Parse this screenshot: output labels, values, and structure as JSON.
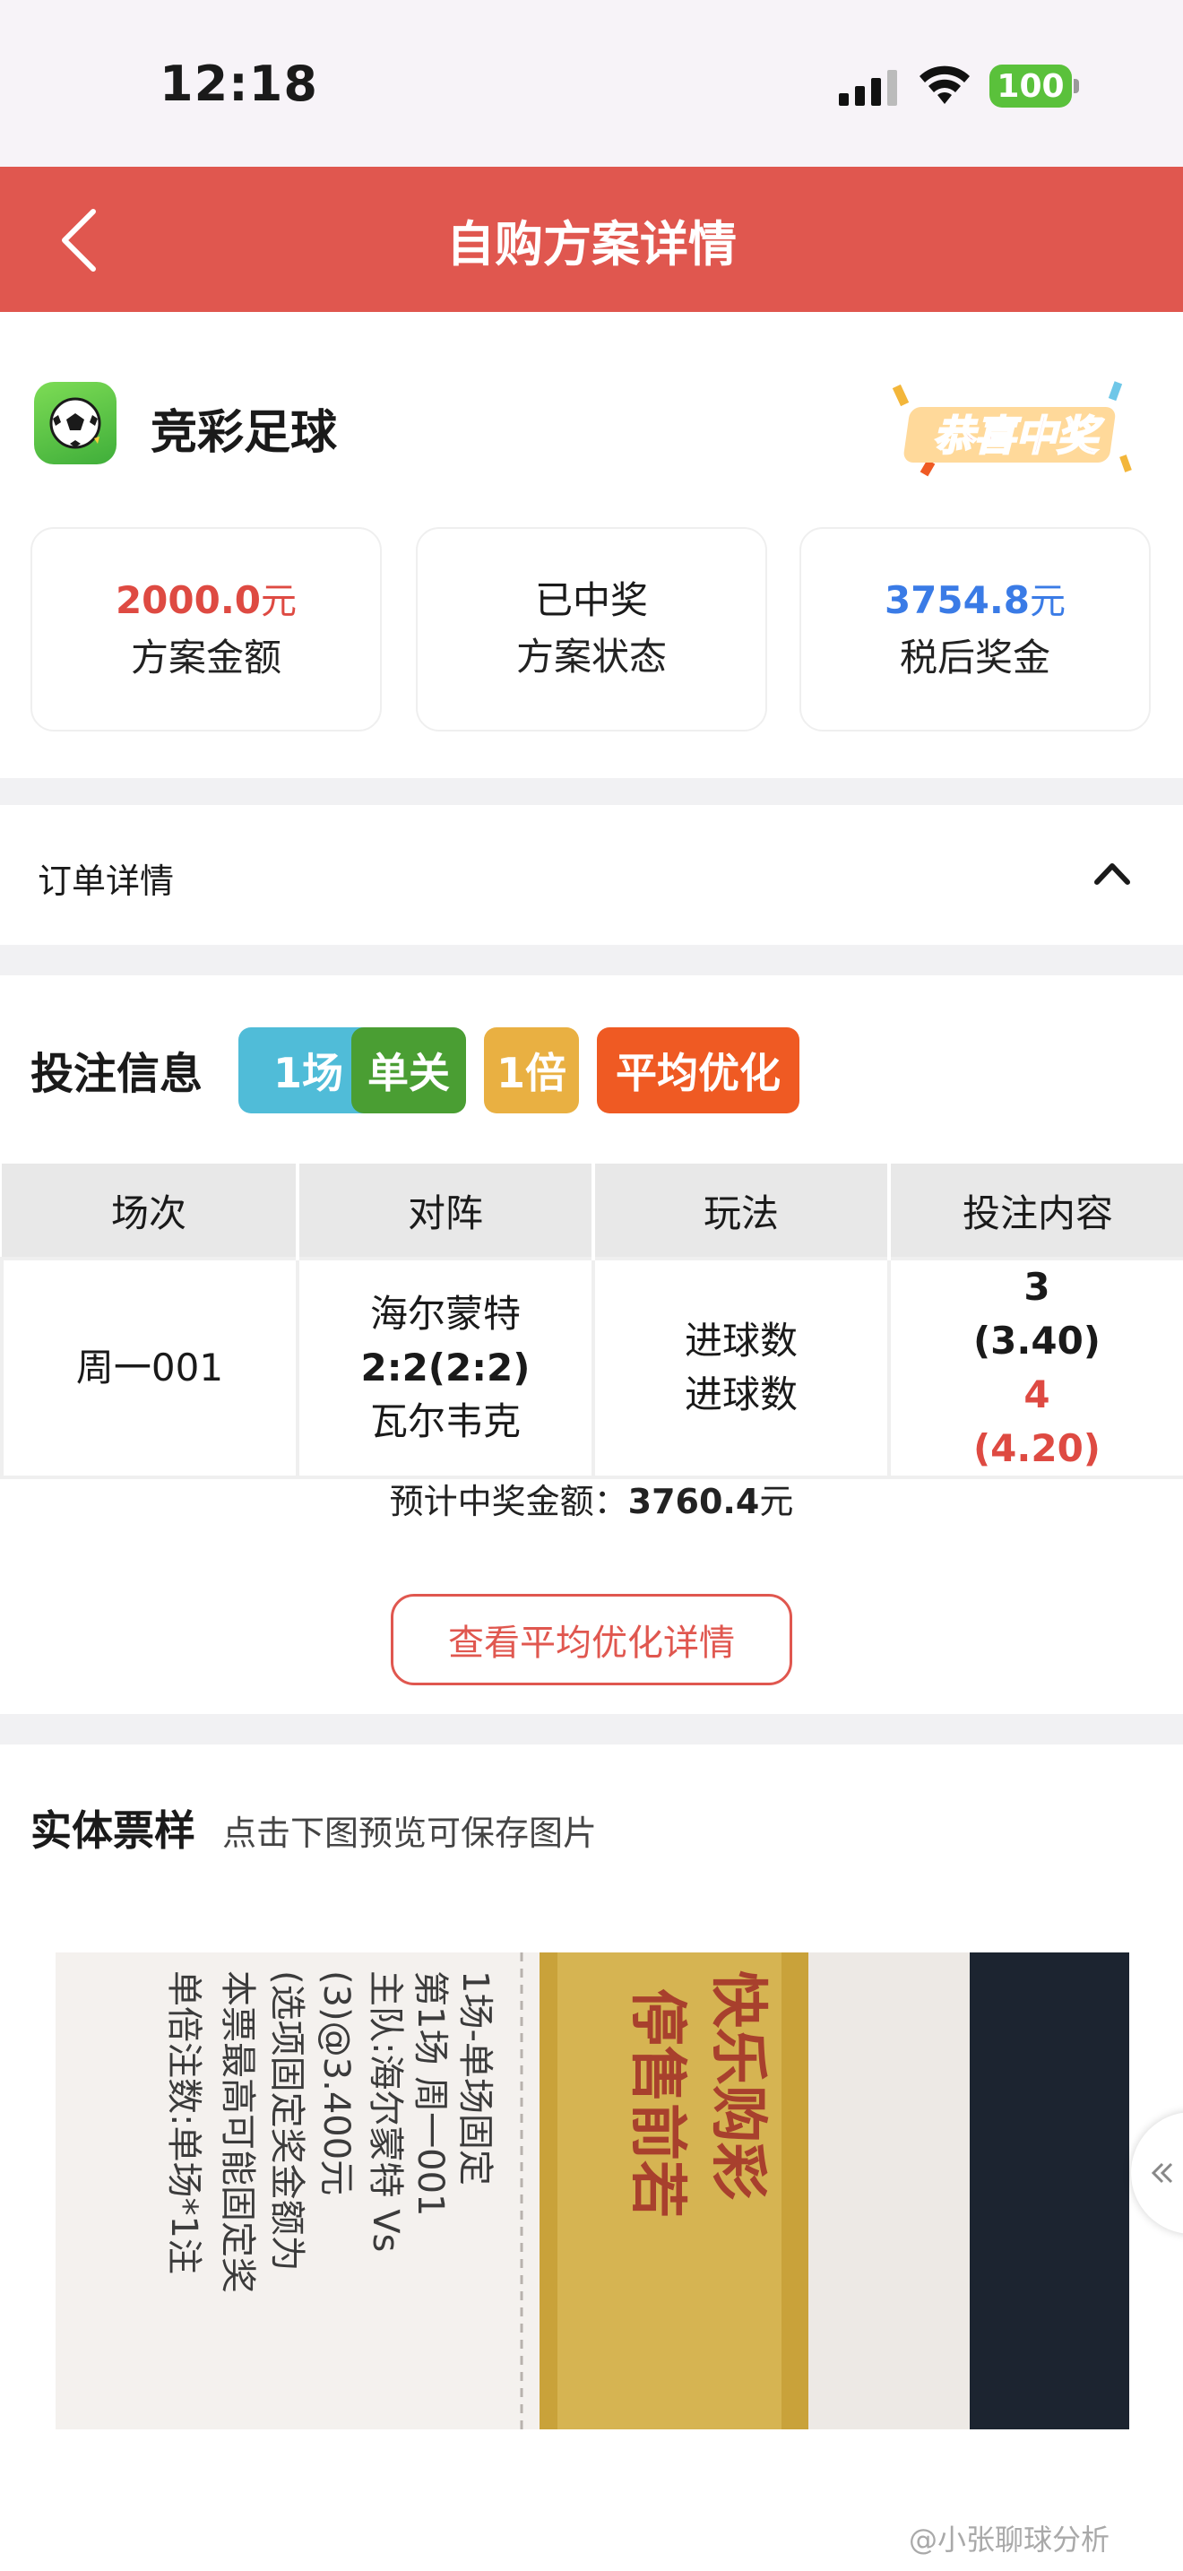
{
  "status_bar": {
    "time": "12:18",
    "battery": "100"
  },
  "nav": {
    "title": "自购方案详情"
  },
  "lottery": {
    "name": "竞彩足球",
    "badge": "恭喜中奖"
  },
  "stats": [
    {
      "value": "2000.0",
      "unit": "元",
      "label": "方案金额",
      "color": "#de4a42"
    },
    {
      "value": "已中奖",
      "unit": "",
      "label": "方案状态",
      "color": "#1a1a1a"
    },
    {
      "value": "3754.8",
      "unit": "元",
      "label": "税后奖金",
      "color": "#3a7be6"
    }
  ],
  "order": {
    "label": "订单详情"
  },
  "bet": {
    "title": "投注信息",
    "tags": [
      {
        "label": "1场",
        "color": "#50bcd8"
      },
      {
        "label": "单关",
        "color": "#4a9e33"
      },
      {
        "label": "1倍",
        "color": "#e9b042"
      },
      {
        "label": "平均优化",
        "color": "#ef5a23"
      }
    ],
    "columns": [
      "场次",
      "对阵",
      "玩法",
      "投注内容"
    ],
    "row": {
      "match_no": "周一001",
      "home": "海尔蒙特",
      "score": "2:2(2:2)",
      "away": "瓦尔韦克",
      "play_1": "进球数",
      "play_2": "进球数",
      "pick_1": "3",
      "odds_1": "(3.40)",
      "pick_2": "4",
      "odds_2": "(4.20)"
    },
    "forecast_label": "预计中奖金额：",
    "forecast_value": "3760.4",
    "forecast_unit": "元",
    "detail_button": "查看平均优化详情"
  },
  "ticket": {
    "title": "实体票样",
    "subtitle": "点击下图预览可保存图片",
    "lines": [
      "1场-单场固定",
      "第1场 周一001",
      "主队:海尔蒙特 Vs",
      "(3)@3.400元",
      "(选项固定奖金额为",
      "本票最高可能固定奖",
      "单倍注数:单场*1注"
    ],
    "gold_text_1": "快乐购彩",
    "gold_text_2": "停售前若"
  },
  "watermark": "@小张聊球分析"
}
